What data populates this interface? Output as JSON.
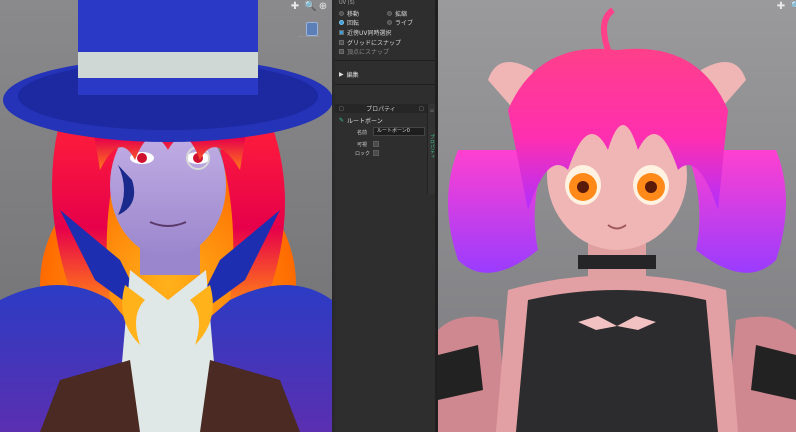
{
  "viewport_left": {
    "tools": [
      "✚",
      "🔍",
      "⊕"
    ]
  },
  "viewport_right": {
    "tools": [
      "✚",
      "🔍"
    ]
  },
  "panel": {
    "header_text": "UV (S)",
    "transform": {
      "move": "移動",
      "scale": "拡縮",
      "rotate": "回転",
      "live": "ライブ",
      "nearby_uv": "近傍UV同時選択",
      "grid_snap": "グリッドにスナップ",
      "vertex_snap": "頂点にスナップ"
    },
    "edit_label": "編集",
    "properties": {
      "title": "プロパティ",
      "node_title": "ルートボーン",
      "name_label": "名前",
      "name_value": "ルートボーン0",
      "visible_label": "可視",
      "lock_label": "ロック",
      "tab_label": "プロパティ"
    }
  }
}
